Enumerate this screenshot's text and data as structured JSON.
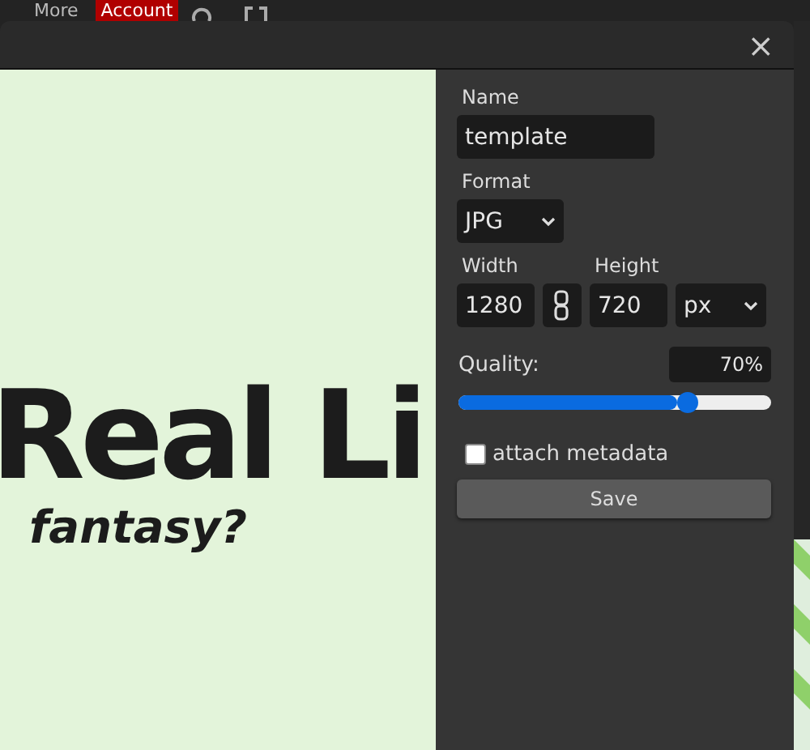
{
  "top_menu": [
    {
      "label": "More",
      "selected": false
    },
    {
      "label": "Account",
      "selected": true
    }
  ],
  "dialog": {
    "close": "×",
    "preview": {
      "headline": "Real Li",
      "subline": "fantasy?"
    },
    "name": {
      "label": "Name",
      "value": "template"
    },
    "format": {
      "label": "Format",
      "value": "JPG"
    },
    "width": {
      "label": "Width",
      "value": "1280"
    },
    "height": {
      "label": "Height",
      "value": "720"
    },
    "unit": "px",
    "quality": {
      "label": "Quality:",
      "reading": "70%",
      "level": 0.7
    },
    "metadata": {
      "label": "attach metadata",
      "checked": false
    },
    "save": "Save"
  }
}
